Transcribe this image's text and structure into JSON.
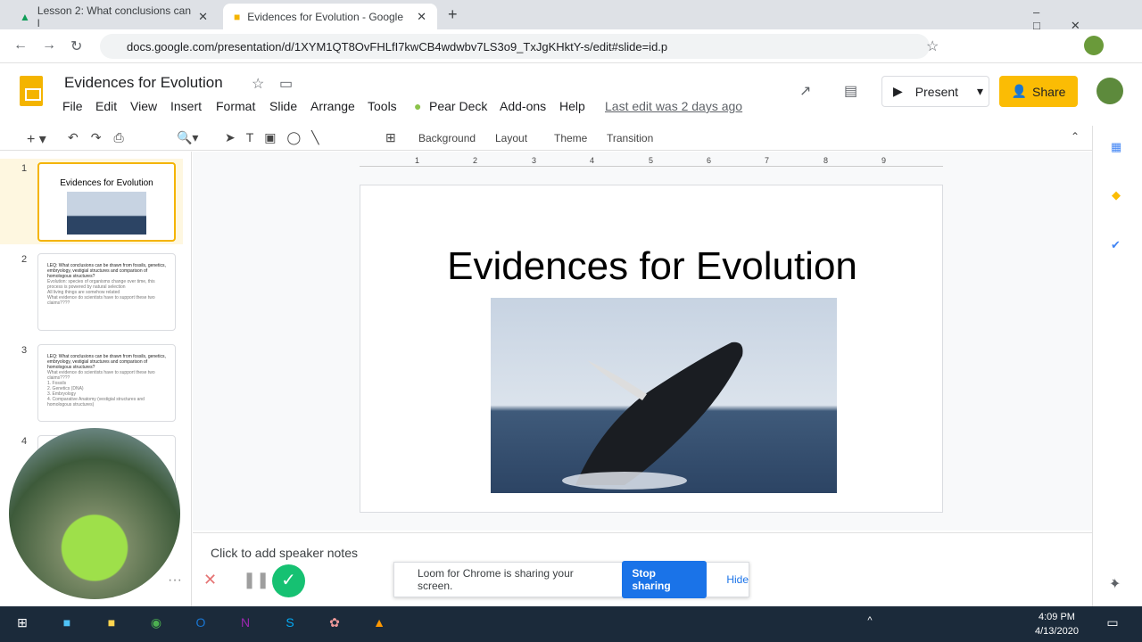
{
  "browser": {
    "tabs": [
      {
        "label": "Lesson 2: What conclusions can l"
      },
      {
        "label": "Evidences for Evolution - Google"
      }
    ],
    "url": "docs.google.com/presentation/d/1XYM1QT8OvFHLfI7kwCB4wdwbv7LS3o9_TxJgKHktY-s/edit#slide=id.p"
  },
  "app": {
    "title": "Evidences for Evolution",
    "menu": [
      "File",
      "Edit",
      "View",
      "Insert",
      "Format",
      "Slide",
      "Arrange",
      "Tools",
      "Pear Deck",
      "Add-ons",
      "Help"
    ],
    "last_edit": "Last edit was 2 days ago",
    "present": "Present",
    "share": "Share"
  },
  "toolbar": {
    "background": "Background",
    "layout": "Layout",
    "theme": "Theme",
    "transition": "Transition"
  },
  "ruler": [
    "1",
    "2",
    "3",
    "4",
    "5",
    "6",
    "7",
    "8",
    "9"
  ],
  "slides": [
    {
      "num": "1",
      "title": "Evidences for Evolution"
    },
    {
      "num": "2",
      "title": "LEQ: What conclusions can be drawn from fossils, genetics, embryology, vestigial structures and comparison of homologous structures?",
      "lines": [
        "Evolution: species of organisms change over time, this process is powered by natural selection",
        "All living things are somehow related",
        "What evidence do scientists have to support these two claims????"
      ]
    },
    {
      "num": "3",
      "title": "LEQ: What conclusions can be drawn from fossils, genetics, embryology, vestigial structures and comparison of homologous structures?",
      "lines": [
        "What evidence do scientists have to support these two claims????",
        "1. Fossils",
        "2. Genetics (DNA)",
        "3. Embryology",
        "4. Comparative Anatomy (vestigial structures and homologous structures)"
      ]
    },
    {
      "num": "4"
    }
  ],
  "main_slide": {
    "title": "Evidences for Evolution"
  },
  "notes": {
    "placeholder": "Click to add speaker notes"
  },
  "loom": {
    "message": "Loom for Chrome is sharing your screen.",
    "stop": "Stop sharing",
    "hide": "Hide"
  },
  "taskbar": {
    "time": "4:09 PM",
    "date": "4/13/2020"
  }
}
